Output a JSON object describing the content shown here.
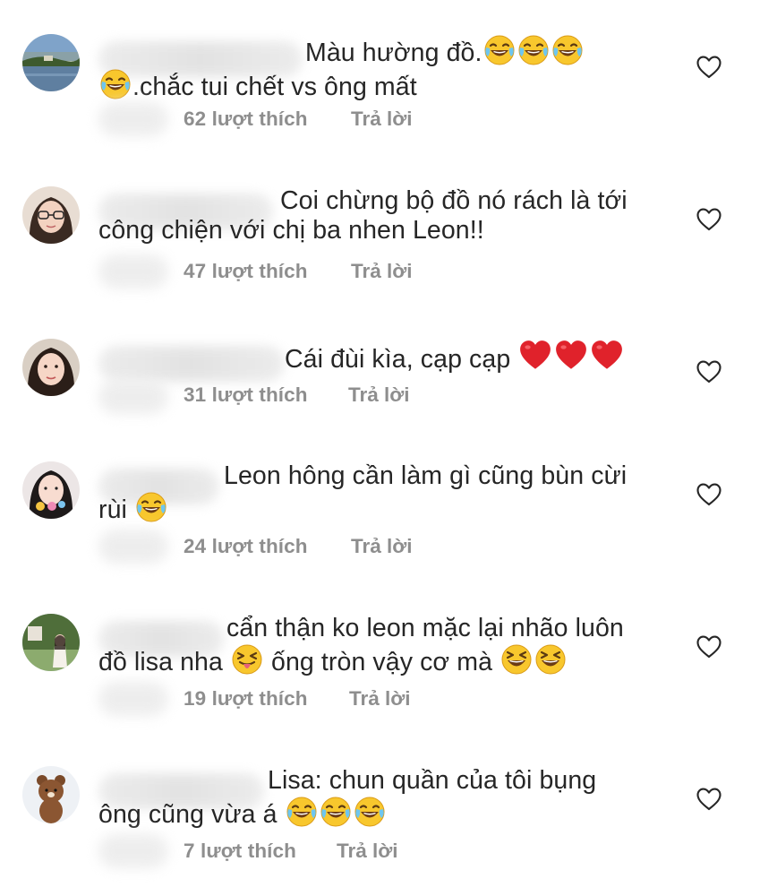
{
  "comments": [
    {
      "avatar": "lake-landscape-avatar",
      "text_line1": "Màu hường đồ.",
      "text_line1_emojis": [
        "laughing-tears-emoji",
        "laughing-tears-emoji",
        "laughing-tears-emoji"
      ],
      "text_line2_lead_emoji": "laughing-tears-emoji",
      "text_line2": ".chắc tui chết vs ông mất",
      "likes": "62 lượt thích",
      "reply": "Trả lời"
    },
    {
      "avatar": "girl-glasses-avatar",
      "text_line1": "Coi chừng bộ đồ nó rách là tới",
      "text_line2": "công chiện với chị ba nhen Leon!!",
      "likes": "47 lượt thích",
      "reply": "Trả lời"
    },
    {
      "avatar": "girl-portrait-avatar",
      "text_line1": "Cái đùi kìa, cạp cạp",
      "text_line1_emojis": [
        "red-heart-emoji",
        "red-heart-emoji",
        "red-heart-emoji"
      ],
      "likes": "31 lượt thích",
      "reply": "Trả lời"
    },
    {
      "avatar": "girl-sticker-avatar",
      "text_line1": "Leon hông cần làm gì cũng bùn cừi",
      "text_line2": "rùi",
      "text_line2_emojis": [
        "laughing-tears-emoji"
      ],
      "likes": "24 lượt thích",
      "reply": "Trả lời"
    },
    {
      "avatar": "girl-outdoor-avatar",
      "text_line1": "cẩn thận ko leon mặc lại nhão luôn",
      "text_line2a": "đồ lisa nha",
      "text_line2b": "ống tròn vậy cơ mà",
      "text_line2_emojis": [
        "tongue-wink-emoji",
        "grinning-squint-emoji",
        "grinning-squint-emoji"
      ],
      "likes": "19 lượt thích",
      "reply": "Trả lời"
    },
    {
      "avatar": "brown-bear-avatar",
      "text_line1": "Lisa: chun quần của tôi bụng",
      "text_line2": "ông cũng vừa á",
      "text_line2_emojis": [
        "laughing-tears-emoji",
        "laughing-tears-emoji",
        "laughing-tears-emoji"
      ],
      "likes": "7 lượt thích",
      "reply": "Trả lời"
    }
  ],
  "icons": {
    "like": "heart-outline-icon"
  },
  "colors": {
    "text": "#262626",
    "secondary": "#8e8e8e",
    "background": "#ffffff"
  }
}
